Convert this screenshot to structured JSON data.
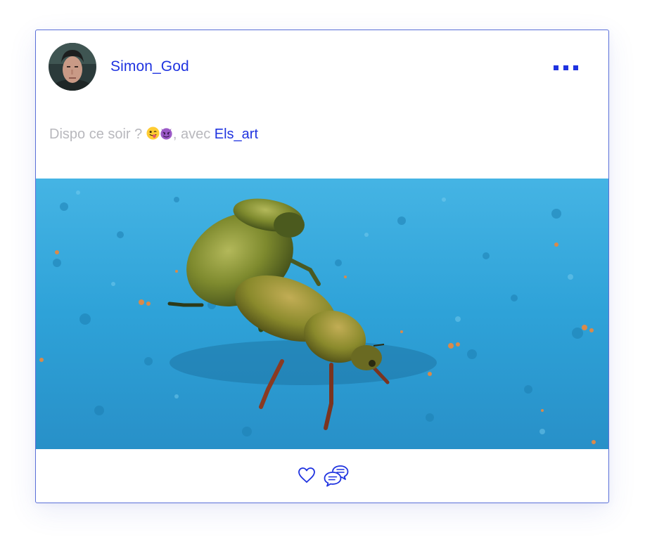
{
  "post": {
    "author": {
      "username": "Simon_God",
      "avatar": "portrait-avatar"
    },
    "more_icon": "ellipsis-icon",
    "caption": {
      "text": "Dispo ce soir ?",
      "emojis": [
        "winking-face-tongue-emoji",
        "smiling-imp-emoji"
      ],
      "with_prefix": ", avec",
      "tagged_user": "Els_art"
    },
    "image": {
      "subject": "two green beetles on blue textured surface"
    },
    "actions": {
      "like_icon": "heart-icon",
      "comment_icon": "chat-bubbles-icon"
    }
  },
  "colors": {
    "accent": "#1f33e0",
    "caption_text": "#b8b8bd",
    "card_border": "#5a6fd8",
    "photo_background": "#2aa3d9"
  }
}
